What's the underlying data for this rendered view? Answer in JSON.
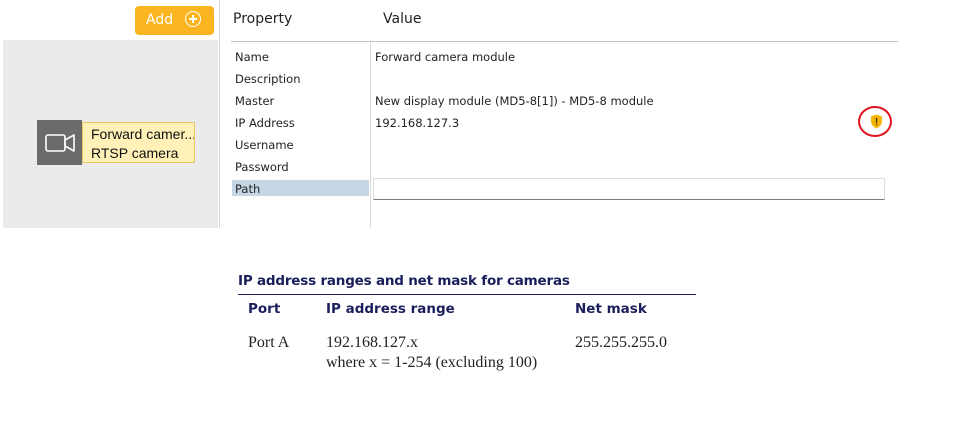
{
  "toolbar": {
    "add_label": "Add",
    "add_icon": "plus-circle-icon"
  },
  "canvas": {
    "node": {
      "icon": "video-camera-icon",
      "title": "Forward camer...",
      "subtitle": "RTSP camera"
    }
  },
  "properties": {
    "header": {
      "property": "Property",
      "value": "Value"
    },
    "rows": [
      {
        "label": "Name",
        "value": "Forward camera module"
      },
      {
        "label": "Description",
        "value": ""
      },
      {
        "label": "Master",
        "value": "New display module (MD5-8[1]) - MD5-8 module"
      },
      {
        "label": "IP Address",
        "value": "192.168.127.3"
      },
      {
        "label": "Username",
        "value": ""
      },
      {
        "label": "Password",
        "value": ""
      },
      {
        "label": "Path",
        "value": ""
      }
    ],
    "warning_icon": "shield-warning-icon",
    "warning_color": "#f5b400",
    "highlight_color": "#e0141e"
  },
  "ip_table": {
    "title": "IP address ranges and net mask for cameras",
    "headers": [
      "Port",
      "IP address range",
      "Net mask"
    ],
    "rows": [
      {
        "port": "Port A",
        "range_line1": "192.168.127.x",
        "range_line2": "where x = 1-254 (excluding 100)",
        "mask": "255.255.255.0"
      }
    ]
  }
}
